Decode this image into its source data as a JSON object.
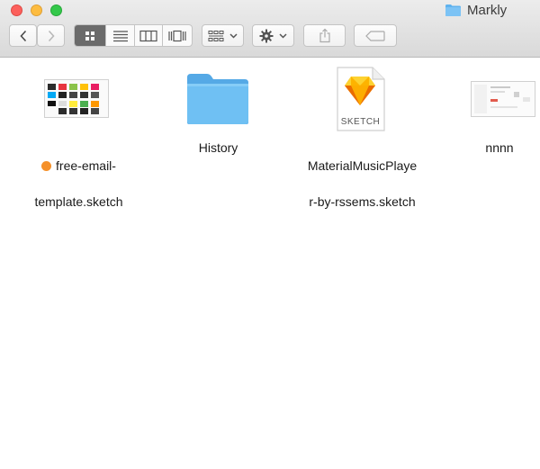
{
  "window": {
    "title": "Markly"
  },
  "toolbar": {
    "back_icon": "chevron-left-icon",
    "forward_icon": "chevron-right-icon",
    "views": [
      "icon-view-icon",
      "list-view-icon",
      "column-view-icon",
      "coverflow-view-icon"
    ],
    "arrange_icon": "arrange-grid-icon",
    "action_icon": "gear-icon",
    "share_icon": "share-icon",
    "tag_icon": "tag-icon"
  },
  "files": [
    {
      "label_line1": "free-email-",
      "label_line2": "template.sketch",
      "tag_color": "#f5902a"
    },
    {
      "label_line1": "History",
      "label_line2": ""
    },
    {
      "label_line1": "MaterialMusicPlaye",
      "label_line2": "r-by-rssems.sketch",
      "doc_badge": "SKETCH"
    },
    {
      "label_line1": "nnnn",
      "label_line2": ""
    }
  ]
}
